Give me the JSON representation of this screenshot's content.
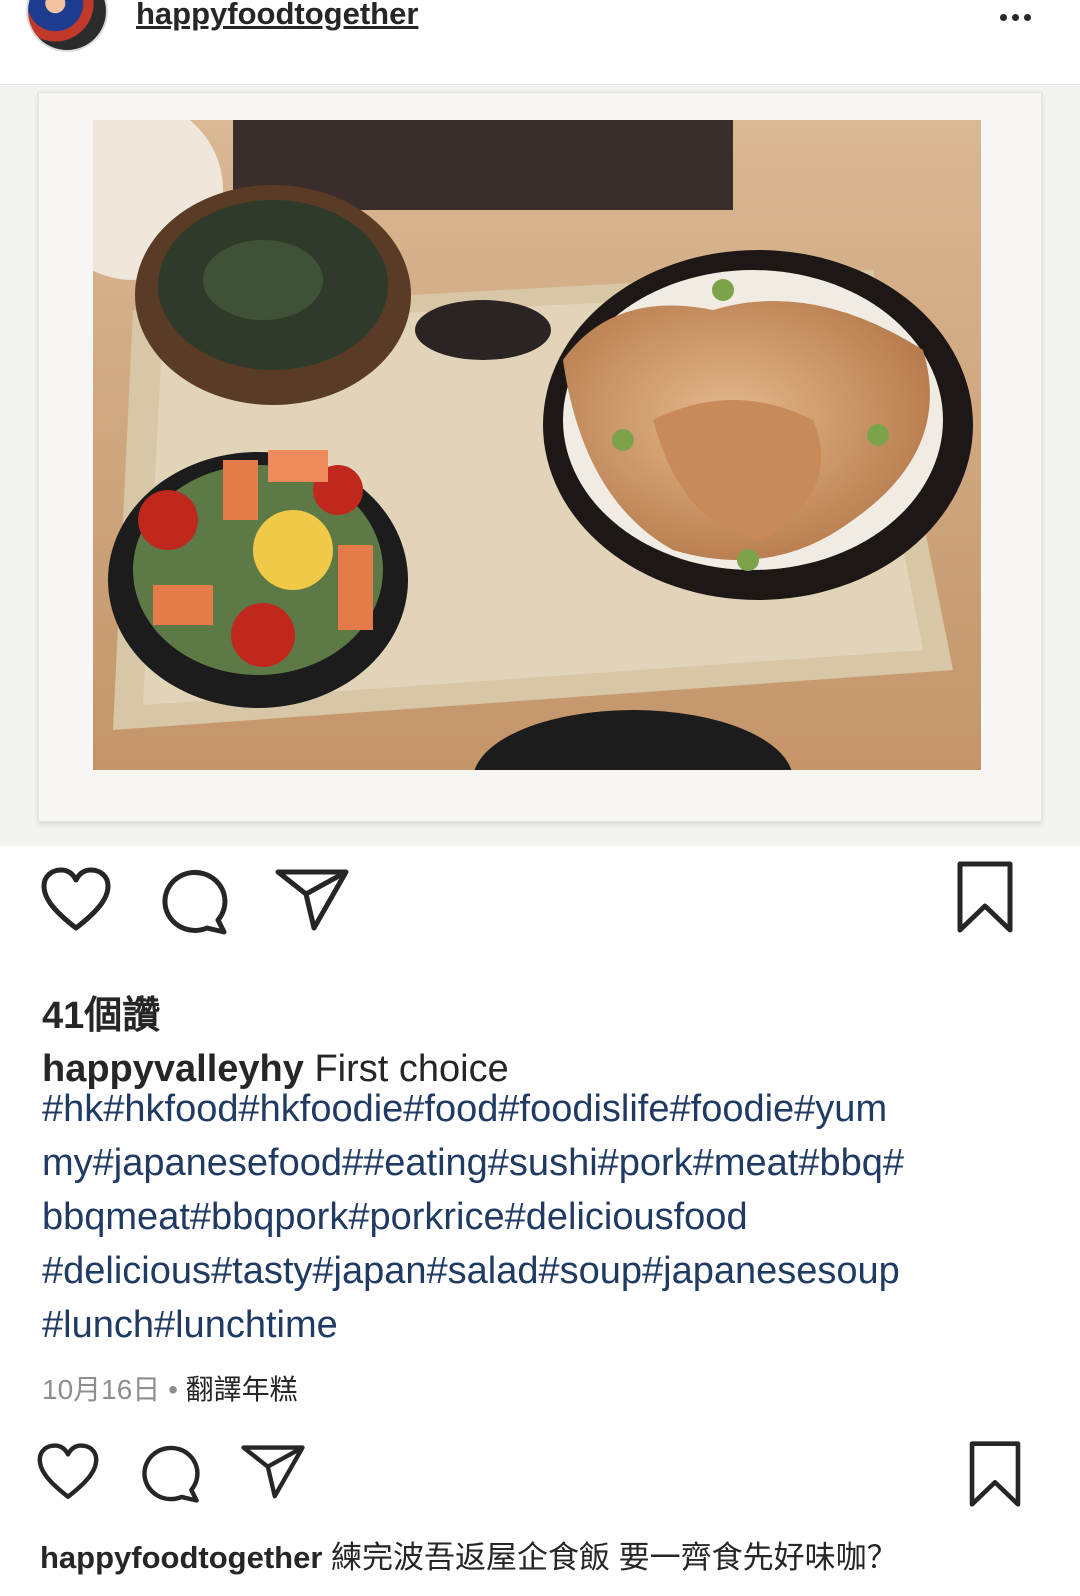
{
  "post": {
    "author": "happyfoodtogether",
    "more_icon": "more-horizontal-icon",
    "photo_description_alt": ""
  },
  "actions": {
    "like_icon": "heart-icon",
    "comment_icon": "comment-icon",
    "share_icon": "send-icon",
    "save_icon": "bookmark-icon"
  },
  "likes": {
    "text": "41個讚"
  },
  "caption": {
    "username": "happyvalleyhy",
    "text": "First choice",
    "hashtag_lines": [
      "#hk#hkfood#hkfoodie#food#foodislife#foodie#yum",
      "my#japanesefood##eating#sushi#pork#meat#bbq#",
      "bbqmeat#bbqpork#porkrice#deliciousfood",
      "#delicious#tasty#japan#salad#soup#japanesesoup",
      "#lunch#lunchtime"
    ]
  },
  "meta": {
    "date": "10月16日",
    "separator": "•",
    "translate": "翻譯年糕"
  },
  "comment": {
    "username": "happyfoodtogether",
    "text": "練完波吾返屋企食飯 要一齊食先好味咖？"
  },
  "colors": {
    "text": "#262626",
    "hashtag": "#1f3a63",
    "muted": "#8e8e8e"
  }
}
